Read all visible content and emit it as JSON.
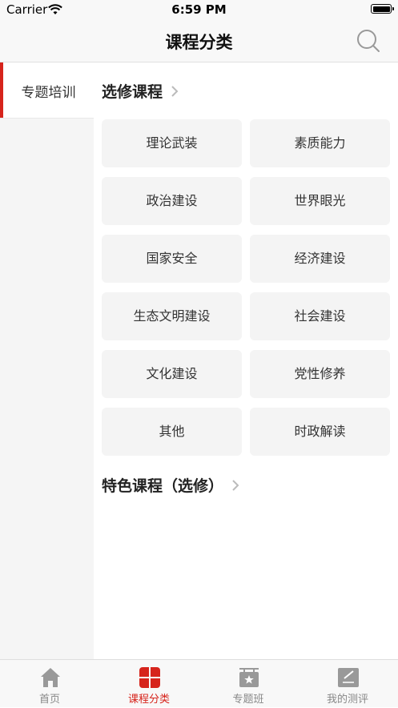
{
  "status_bar": {
    "carrier": "Carrier",
    "time": "6:59 PM"
  },
  "navbar": {
    "title": "课程分类",
    "search_icon": "search-icon"
  },
  "sidebar": {
    "items": [
      {
        "label": "专题培训",
        "active": true
      }
    ]
  },
  "content": {
    "sections": [
      {
        "title": "选修课程",
        "buttons": [
          "理论武装",
          "素质能力",
          "政治建设",
          "世界眼光",
          "国家安全",
          "经济建设",
          "生态文明建设",
          "社会建设",
          "文化建设",
          "党性修养",
          "其他",
          "时政解读"
        ]
      },
      {
        "title": "特色课程（选修）",
        "buttons": []
      }
    ]
  },
  "tabbar": {
    "tabs": [
      {
        "label": "首页",
        "icon": "home-icon"
      },
      {
        "label": "课程分类",
        "icon": "category-grid-icon",
        "active": true
      },
      {
        "label": "专题班",
        "icon": "star-board-icon"
      },
      {
        "label": "我的测评",
        "icon": "evaluation-icon"
      }
    ]
  },
  "colors": {
    "accent": "#d6241c",
    "button_bg": "#f4f4f4",
    "inactive_tab": "#888888"
  }
}
